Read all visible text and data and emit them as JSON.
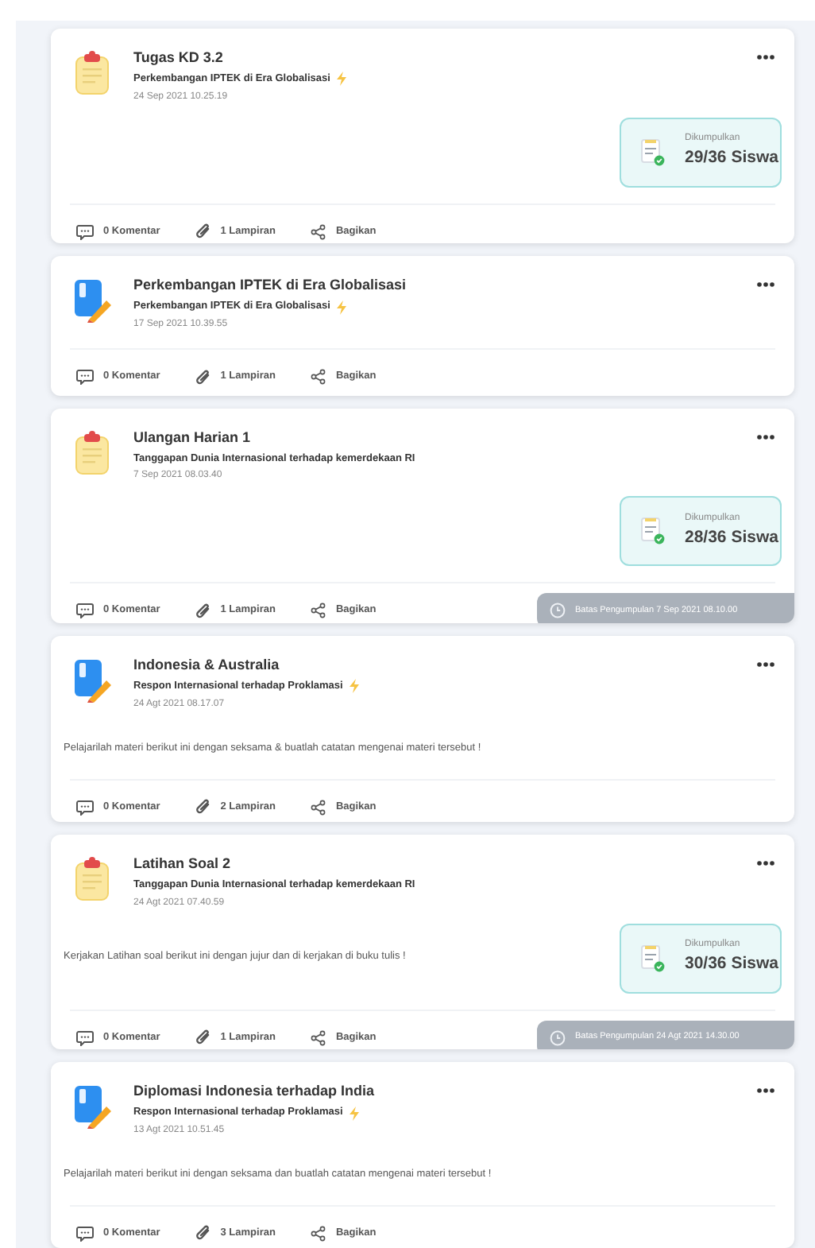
{
  "posts": [
    {
      "kind": "tugas",
      "title": "Tugas KD 3.2",
      "topic": "Perkembangan IPTEK di Era Globalisasi",
      "flash": true,
      "date": "24 Sep 2021 10.25.19",
      "submitted": {
        "label": "Dikumpulkan",
        "count": "29/36 Siswa"
      },
      "comments": "0 Komentar",
      "attachments": "1 Lampiran",
      "share": "Bagikan"
    },
    {
      "kind": "materi",
      "title": "Perkembangan IPTEK di Era Globalisasi",
      "topic": "Perkembangan IPTEK di Era Globalisasi",
      "flash": true,
      "date": "17 Sep 2021 10.39.55",
      "comments": "0 Komentar",
      "attachments": "1 Lampiran",
      "share": "Bagikan"
    },
    {
      "kind": "tugas",
      "title": "Ulangan Harian 1",
      "topic": "Tanggapan Dunia Internasional terhadap kemerdekaan RI",
      "flash": false,
      "date": "7 Sep 2021 08.03.40",
      "submitted": {
        "label": "Dikumpulkan",
        "count": "28/36 Siswa"
      },
      "comments": "0 Komentar",
      "attachments": "1 Lampiran",
      "share": "Bagikan",
      "deadline": "Batas Pengumpulan 7 Sep 2021 08.10.00"
    },
    {
      "kind": "materi",
      "title": "Indonesia & Australia",
      "topic": "Respon Internasional terhadap Proklamasi",
      "flash": true,
      "date": "24 Agt 2021 08.17.07",
      "description": "Pelajarilah materi berikut ini dengan seksama & buatlah catatan mengenai materi tersebut !",
      "comments": "0 Komentar",
      "attachments": "2 Lampiran",
      "share": "Bagikan"
    },
    {
      "kind": "tugas",
      "title": "Latihan Soal 2",
      "topic": "Tanggapan Dunia Internasional terhadap kemerdekaan RI",
      "flash": false,
      "date": "24 Agt 2021 07.40.59",
      "description": "Kerjakan Latihan soal berikut ini dengan jujur dan di kerjakan di buku tulis !",
      "submitted": {
        "label": "Dikumpulkan",
        "count": "30/36 Siswa"
      },
      "comments": "0 Komentar",
      "attachments": "1 Lampiran",
      "share": "Bagikan",
      "deadline": "Batas Pengumpulan 24 Agt 2021 14.30.00"
    },
    {
      "kind": "materi",
      "title": "Diplomasi Indonesia terhadap India",
      "topic": "Respon Internasional terhadap Proklamasi",
      "flash": true,
      "date": "13 Agt 2021 10.51.45",
      "description": "Pelajarilah materi berikut ini dengan seksama dan buatlah catatan mengenai materi tersebut !",
      "comments": "0 Komentar",
      "attachments": "3 Lampiran",
      "share": "Bagikan"
    }
  ]
}
